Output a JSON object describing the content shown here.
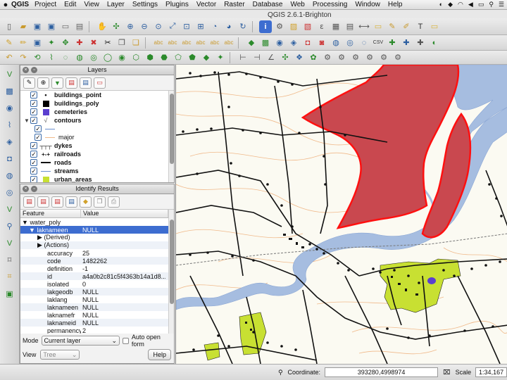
{
  "menubar": {
    "app": "QGIS",
    "items": [
      "Project",
      "Edit",
      "View",
      "Layer",
      "Settings",
      "Plugins",
      "Vector",
      "Raster",
      "Database",
      "Web",
      "Processing",
      "Window",
      "Help"
    ]
  },
  "window_title": "QGIS 2.6.1-Brighton",
  "layers_panel": {
    "title": "Layers",
    "layers": [
      {
        "label": "buildings_point",
        "symbol": "point"
      },
      {
        "label": "buildings_poly",
        "symbol": "black-fill"
      },
      {
        "label": "cemeteries",
        "symbol": "purple-fill"
      },
      {
        "label": "contours",
        "symbol": "contour"
      },
      {
        "label": "",
        "symbol": "line-blue"
      },
      {
        "label": "major",
        "symbol": "line-orange"
      },
      {
        "label": "dykes",
        "symbol": "dyke-line"
      },
      {
        "label": "railroads",
        "symbol": "rail-line"
      },
      {
        "label": "roads",
        "symbol": "road-line"
      },
      {
        "label": "streams",
        "symbol": "stream-line"
      },
      {
        "label": "urban_areas",
        "symbol": "green-fill"
      }
    ]
  },
  "identify_panel": {
    "title": "Identify Results",
    "columns": {
      "feature": "Feature",
      "value": "Value"
    },
    "rows": [
      {
        "feature": "water_poly",
        "value": "",
        "level": 0,
        "expander": "▼"
      },
      {
        "feature": "laknameen",
        "value": "NULL",
        "level": 1,
        "expander": "▼",
        "selected": true
      },
      {
        "feature": "(Derived)",
        "value": "",
        "level": 2,
        "expander": "▶"
      },
      {
        "feature": "(Actions)",
        "value": "",
        "level": 2,
        "expander": "▶"
      },
      {
        "feature": "accuracy",
        "value": "25",
        "level": 2
      },
      {
        "feature": "code",
        "value": "1482262",
        "level": 2
      },
      {
        "feature": "definition",
        "value": "-1",
        "level": 2
      },
      {
        "feature": "id",
        "value": "a4a0b2c81c5f4363b14a1d8...",
        "level": 2
      },
      {
        "feature": "isolated",
        "value": "0",
        "level": 2
      },
      {
        "feature": "lakgeodb",
        "value": "NULL",
        "level": 2
      },
      {
        "feature": "laklang",
        "value": "NULL",
        "level": 2
      },
      {
        "feature": "laknameen",
        "value": "NULL",
        "level": 2
      },
      {
        "feature": "laknamefr",
        "value": "NULL",
        "level": 2
      },
      {
        "feature": "laknameid",
        "value": "NULL",
        "level": 2
      },
      {
        "feature": "permanency",
        "value": "2",
        "level": 2
      }
    ],
    "mode_label": "Mode",
    "mode_value": "Current layer",
    "auto_open_label": "Auto open form",
    "view_label": "View",
    "view_value": "Tree",
    "help_label": "Help"
  },
  "statusbar": {
    "coordinate_label": "Coordinate:",
    "coordinate_value": "393280,4998974",
    "scale_label": "Scale",
    "scale_value": "1:34,167"
  },
  "colors": {
    "water": "#a6bde0",
    "selected_water": "#c9484f",
    "selected_outline": "#ff1010",
    "urban": "#c8e032",
    "contour": "#f0b98a",
    "road": "#111111",
    "selection": "#3d6dd0"
  },
  "icons": [
    "apple-icon",
    "new-project-icon",
    "open-icon",
    "save-icon",
    "pan-icon",
    "zoom-in-icon",
    "zoom-out-icon",
    "identify-icon",
    "refresh-icon"
  ]
}
